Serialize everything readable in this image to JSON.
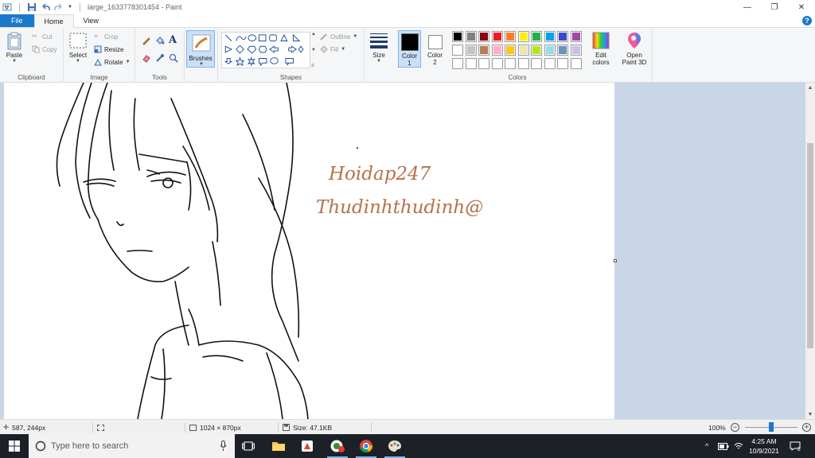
{
  "window": {
    "title": "large_1633778301454 - Paint"
  },
  "tabs": [
    {
      "label": "File"
    },
    {
      "label": "Home"
    },
    {
      "label": "View"
    }
  ],
  "ribbon": {
    "clipboard": {
      "label": "Clipboard",
      "paste": "Paste",
      "cut": "Cut",
      "copy": "Copy"
    },
    "image": {
      "label": "Image",
      "select": "Select",
      "crop": "Crop",
      "resize": "Resize",
      "rotate": "Rotate"
    },
    "tools": {
      "label": "Tools"
    },
    "brushes": {
      "label": "Brushes"
    },
    "shapes": {
      "label": "Shapes",
      "outline": "Outline",
      "fill": "Fill"
    },
    "size": {
      "label": "Size"
    },
    "color1": {
      "label": "Color",
      "sub": "1",
      "value": "#000000"
    },
    "color2": {
      "label": "Color",
      "sub": "2",
      "value": "#ffffff"
    },
    "colors": {
      "label": "Colors",
      "row1": [
        "#000000",
        "#7f7f7f",
        "#880015",
        "#ed1c24",
        "#ff7f27",
        "#fff200",
        "#22b14c",
        "#00a2e8",
        "#3f48cc",
        "#a349a4"
      ],
      "row2": [
        "#ffffff",
        "#c3c3c3",
        "#b97a57",
        "#ffaec9",
        "#ffc90e",
        "#efe4b0",
        "#b5e61d",
        "#99d9ea",
        "#7092be",
        "#c8bfe7"
      ],
      "row3": [
        "#ffffff",
        "#ffffff",
        "#ffffff",
        "#ffffff",
        "#ffffff",
        "#ffffff",
        "#ffffff",
        "#ffffff",
        "#ffffff",
        "#ffffff"
      ]
    },
    "edit_colors": {
      "line1": "Edit",
      "line2": "colors"
    },
    "open_paint3d": {
      "line1": "Open",
      "line2": "Paint 3D"
    }
  },
  "canvas": {
    "signature1": "Hoidap247",
    "signature2": "Thudinhthudinh@"
  },
  "status": {
    "cursor_pos": "587, 244px",
    "dimensions": "1024 × 870px",
    "size": "Size: 47.1KB",
    "zoom": "100%",
    "zoom_fraction": 0.5
  },
  "taskbar": {
    "search_placeholder": "Type here to search",
    "time": "4:25 AM",
    "date": "10/9/2021",
    "notifications": "2"
  }
}
